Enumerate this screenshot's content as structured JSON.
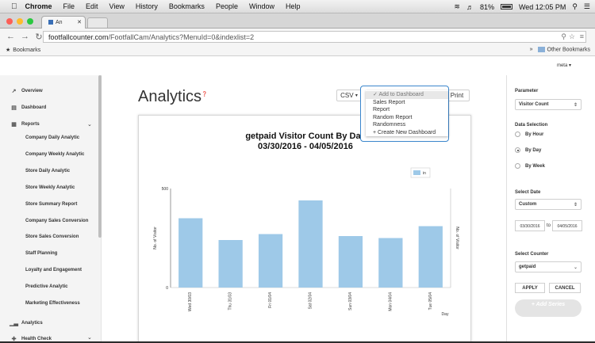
{
  "menubar": {
    "app": "Chrome",
    "items": [
      "File",
      "Edit",
      "View",
      "History",
      "Bookmarks",
      "People",
      "Window",
      "Help"
    ],
    "battery": "81%",
    "clock": "Wed 12:05 PM"
  },
  "browser": {
    "tab_title": "An",
    "url_host": "footfallcounter.com",
    "url_path": "/FootfallCam/Analytics?MenuId=0&indexlist=2",
    "bookmarks_label": "Bookmarks",
    "other_bookmarks": "Other Bookmarks"
  },
  "user": {
    "name": "meta"
  },
  "sidebar": {
    "items": [
      {
        "label": "Overview",
        "icon": "line-chart-icon"
      },
      {
        "label": "Dashboard",
        "icon": "dashboard-icon"
      },
      {
        "label": "Reports",
        "icon": "document-icon"
      }
    ],
    "reports": [
      "Company Daily Analytic",
      "Company Weekly Analytic",
      "Store Daily Analytic",
      "Store Weekly Analytic",
      "Store Summary Report",
      "Company Sales Conversion",
      "Store Sales Conversion",
      "Staff Planning",
      "Loyalty and Engagement",
      "Predictive Analytic",
      "Marketing Effectiveness"
    ],
    "bottom": [
      {
        "label": "Analytics",
        "icon": "bar-chart-icon"
      },
      {
        "label": "Health Check",
        "icon": "health-icon"
      }
    ]
  },
  "main": {
    "title": "Analytics",
    "csv_label": "CSV",
    "print_label": "Print"
  },
  "dropdown": {
    "items": [
      "Add to Dashboard",
      "Sales Report",
      "Report",
      "Random Report",
      "Randomness",
      "+ Create New Dashboard"
    ]
  },
  "chart_data": {
    "type": "bar",
    "title": "getpaid Visitor Count By Day",
    "subtitle": "03/30/2016 - 04/05/2016",
    "categories": [
      "Wed 30/03",
      "Thu 31/03",
      "Fri 01/04",
      "Sat 02/04",
      "Sun 03/04",
      "Mon 04/04",
      "Tue 05/04"
    ],
    "series": [
      {
        "name": "in",
        "values": [
          350,
          240,
          270,
          440,
          260,
          250,
          310
        ]
      }
    ],
    "ylabel": "No. of Visitor",
    "y2label": "No. of Visitor",
    "xlabel": "Day",
    "ylim": [
      0,
      500
    ],
    "y_ticks": [
      "0",
      "500"
    ],
    "legend_position": "top-right",
    "color": "#9ec9e8"
  },
  "right_panel": {
    "parameter_label": "Parameter",
    "parameter_value": "Visitor Count",
    "data_selection_label": "Data Selection",
    "options": [
      {
        "label": "By Hour",
        "checked": false
      },
      {
        "label": "By Day",
        "checked": true
      },
      {
        "label": "By Week",
        "checked": false
      }
    ],
    "select_date_label": "Select Date",
    "date_mode": "Custom",
    "date_from": "03/30/2016",
    "date_to_label": "to",
    "date_to": "04/05/2016",
    "select_counter_label": "Select Counter",
    "counter_value": "getpaid",
    "apply_label": "APPLY",
    "cancel_label": "CANCEL",
    "add_series_label": "+ Add Series"
  }
}
